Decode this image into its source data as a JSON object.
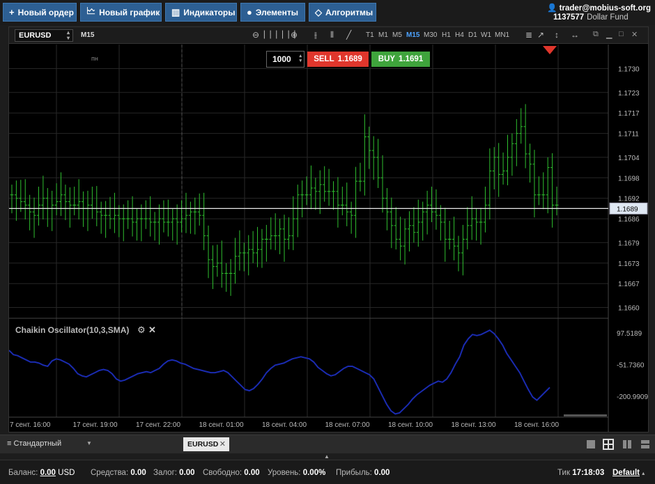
{
  "toolbar": {
    "new_order": "Новый ордер",
    "new_chart": "Новый график",
    "indicators": "Индикаторы",
    "elements": "Элементы",
    "algorithms": "Алгоритмы"
  },
  "account": {
    "user": "trader@mobius-soft.org",
    "number": "1137577",
    "fund": "Dollar Fund"
  },
  "chart": {
    "symbol": "EURUSD",
    "timeframe": "M15",
    "timeframes": [
      "T1",
      "M1",
      "M5",
      "M15",
      "M30",
      "H1",
      "H4",
      "D1",
      "W1",
      "MN1"
    ],
    "active_timeframe": "M15",
    "day_marker": "пн",
    "current_price": "1.1689",
    "quantity": "1000",
    "sell_label": "SELL",
    "sell_price": "1.1689",
    "buy_label": "BUY",
    "buy_price": "1.1691",
    "indicator_name": "Chaikin Oscillator(10,3,SMA)"
  },
  "chart_data": {
    "type": "ohlc",
    "price_ticks": [
      "1.1730",
      "1.1723",
      "1.1717",
      "1.1711",
      "1.1704",
      "1.1698",
      "1.1692",
      "1.1686",
      "1.1679",
      "1.1673",
      "1.1667",
      "1.1660"
    ],
    "price_ylim": [
      1.1655,
      1.1735
    ],
    "oscillator_ticks": [
      "97.5189",
      "-51.7360",
      "-200.9909"
    ],
    "x_labels": [
      "7 сент. 16:00",
      "17 сент. 19:00",
      "17 сент. 22:00",
      "18 сент. 01:00",
      "18 сент. 04:00",
      "18 сент. 07:00",
      "18 сент. 10:00",
      "18 сент. 13:00",
      "18 сент. 16:00"
    ],
    "closes": [
      1.1693,
      1.1692,
      1.1691,
      1.169,
      1.1688,
      1.1687,
      1.169,
      1.1692,
      1.1689,
      1.169,
      1.1691,
      1.1693,
      1.1691,
      1.169,
      1.169,
      1.1691,
      1.1689,
      1.169,
      1.1689,
      1.1688,
      1.1687,
      1.1687,
      1.1686,
      1.1687,
      1.1686,
      1.1686,
      1.1686,
      1.1685,
      1.1686,
      1.1686,
      1.1686,
      1.1685,
      1.1685,
      1.1686,
      1.1685,
      1.1685,
      1.1686,
      1.1685,
      1.1686,
      1.1687,
      1.1688,
      1.1688,
      1.1687,
      1.1681,
      1.1674,
      1.1672,
      1.1673,
      1.167,
      1.167,
      1.167,
      1.1675,
      1.1676,
      1.1676,
      1.1677,
      1.1676,
      1.1677,
      1.168,
      1.168,
      1.1681,
      1.1681,
      1.1683,
      1.168,
      1.1681,
      1.1686,
      1.1693,
      1.1693,
      1.1693,
      1.1695,
      1.1694,
      1.1696,
      1.1694,
      1.1694,
      1.1694,
      1.169,
      1.169,
      1.1688,
      1.1687,
      1.1697,
      1.1697,
      1.171,
      1.1706,
      1.1704,
      1.1698,
      1.1692,
      1.1688,
      1.1684,
      1.168,
      1.1678,
      1.1683,
      1.1684,
      1.1682,
      1.1685,
      1.1688,
      1.169,
      1.1688,
      1.1687,
      1.1685,
      1.168,
      1.168,
      1.1678,
      1.1676,
      1.168,
      1.1684,
      1.1686,
      1.1685,
      1.1685,
      1.169,
      1.17,
      1.1704,
      1.1699,
      1.17,
      1.1704,
      1.1708,
      1.1711,
      1.1713,
      1.1705,
      1.1702,
      1.1693,
      1.1693,
      1.1693,
      1.1701,
      1.169,
      1.169
    ],
    "oscillator": [
      15,
      -5,
      -10,
      -20,
      -30,
      -40,
      -40,
      -45,
      -55,
      -60,
      -35,
      -25,
      -30,
      -40,
      -50,
      -70,
      -95,
      -105,
      -110,
      -100,
      -90,
      -80,
      -75,
      -80,
      -95,
      -120,
      -130,
      -125,
      -115,
      -105,
      -95,
      -90,
      -85,
      -90,
      -80,
      -70,
      -50,
      -35,
      -30,
      -35,
      -45,
      -50,
      -60,
      -70,
      -75,
      -80,
      -85,
      -90,
      -90,
      -85,
      -80,
      -90,
      -110,
      -130,
      -150,
      -170,
      -175,
      -165,
      -145,
      -120,
      -90,
      -70,
      -55,
      -50,
      -45,
      -35,
      -25,
      -20,
      -15,
      -20,
      -25,
      -40,
      -65,
      -80,
      -95,
      -105,
      -100,
      -85,
      -70,
      -60,
      -60,
      -70,
      -80,
      -90,
      -100,
      -120,
      -160,
      -200,
      -240,
      -270,
      -285,
      -280,
      -260,
      -240,
      -215,
      -195,
      -180,
      -165,
      -150,
      -140,
      -130,
      -135,
      -120,
      -90,
      -50,
      -15,
      40,
      70,
      90,
      85,
      90,
      100,
      110,
      95,
      70,
      40,
      0,
      -30,
      -60,
      -90,
      -130,
      -170,
      -205,
      -220,
      -200,
      -180,
      -160
    ]
  },
  "tabbar": {
    "profile": "Стандартный",
    "active_tab": "EURUSD"
  },
  "status": {
    "balance_label": "Баланс:",
    "balance_value": "0.00",
    "balance_currency": "USD",
    "equity_label": "Средства:",
    "equity_value": "0.00",
    "margin_label": "Залог:",
    "margin_value": "0.00",
    "free_label": "Свободно:",
    "free_value": "0.00",
    "level_label": "Уровень:",
    "level_value": "0.00%",
    "profit_label": "Прибыль:",
    "profit_value": "0.00",
    "tick_label": "Тик",
    "tick_value": "17:18:03",
    "profile_name": "Default"
  },
  "colors": {
    "bar": "#2fbf2f",
    "oscillator": "#1a2bb0",
    "sell": "#e0362c",
    "buy": "#3fa43c",
    "toolbar": "#2d5f93"
  }
}
